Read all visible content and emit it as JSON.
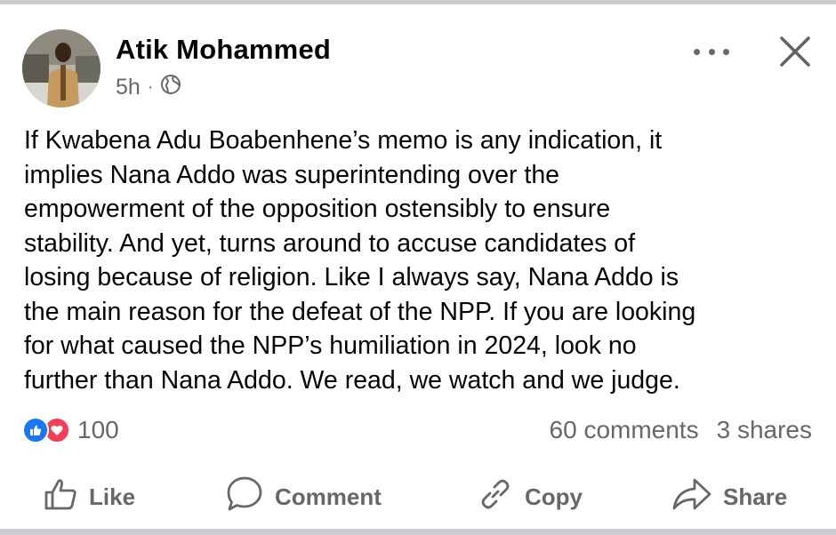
{
  "post": {
    "author": "Atik Mohammed",
    "time": "5h",
    "separator": "·",
    "audience_icon": "globe-icon",
    "lines": [
      "If Kwabena Adu Boabenhene’s memo is any indication, it",
      "implies Nana Addo was superintending over the",
      "empowerment of the opposition ostensibly to ensure",
      "stability. And yet, turns around to accuse candidates of",
      "losing because of religion. Like I always say, Nana Addo is",
      "the main reason for the defeat of the NPP. If you are looking",
      "for what caused the NPP’s humiliation in 2024, look no",
      "further than Nana Addo. We read, we watch and we judge."
    ]
  },
  "engagement": {
    "reaction_count": "100",
    "comments": "60 comments",
    "shares": "3 shares"
  },
  "actions": {
    "like": "Like",
    "comment": "Comment",
    "copy": "Copy",
    "share": "Share"
  },
  "colors": {
    "secondary_text": "#65676b",
    "like_blue": "#1877f2",
    "love_red": "#f33e58"
  }
}
